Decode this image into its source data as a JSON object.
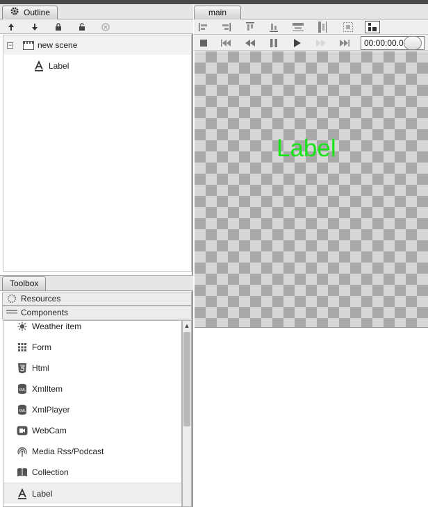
{
  "outline": {
    "tab_label": "Outline",
    "toolbar": [
      {
        "icon": "arrow-up-icon",
        "glyph": "🡑"
      },
      {
        "icon": "arrow-down-icon",
        "glyph": "🡓"
      },
      {
        "icon": "lock-icon",
        "glyph": "🔒"
      },
      {
        "icon": "unlock-icon",
        "glyph": "🔓"
      },
      {
        "icon": "delete-icon",
        "glyph": "⊗"
      }
    ],
    "tree": {
      "scene_label": "new scene",
      "child_label": "Label",
      "expander": "−"
    }
  },
  "toolbox": {
    "tab_label": "Toolbox",
    "sections": {
      "resources": "Resources",
      "components": "Components"
    },
    "items": [
      {
        "label": "Weather item",
        "icon": "weather-icon"
      },
      {
        "label": "Form",
        "icon": "form-grid-icon"
      },
      {
        "label": "Html",
        "icon": "html5-icon"
      },
      {
        "label": "XmlItem",
        "icon": "xml-item-icon"
      },
      {
        "label": "XmlPlayer",
        "icon": "xml-player-icon"
      },
      {
        "label": "WebCam",
        "icon": "webcam-icon"
      },
      {
        "label": "Media Rss/Podcast",
        "icon": "podcast-icon"
      },
      {
        "label": "Collection",
        "icon": "collection-icon"
      },
      {
        "label": "Label",
        "icon": "label-a-icon"
      }
    ],
    "selected_item": "Label",
    "scroll_up_glyph": "▲"
  },
  "editor": {
    "tab_label": "main",
    "time_value": "00:00:00.0",
    "canvas_label": "Label",
    "canvas_label_color": "#18e418"
  }
}
